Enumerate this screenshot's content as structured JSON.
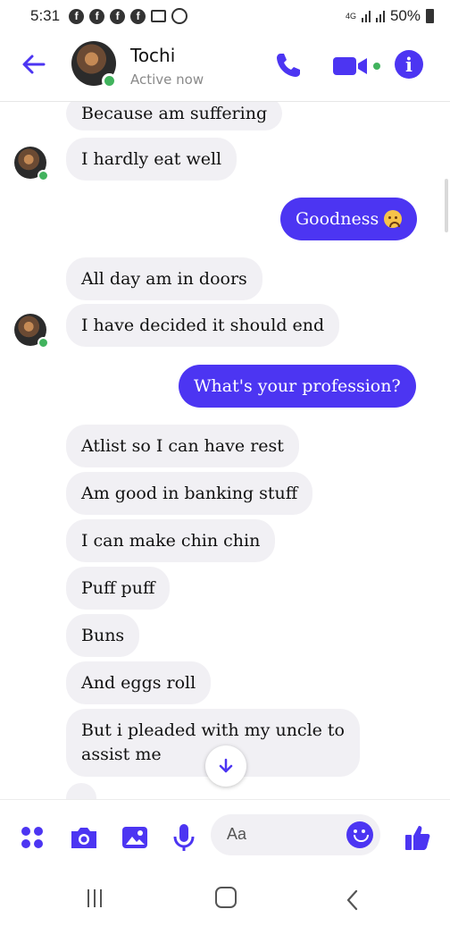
{
  "status_bar": {
    "time": "5:31",
    "network": "4G",
    "battery": "50%"
  },
  "header": {
    "name": "Tochi",
    "status": "Active now"
  },
  "messages": [
    {
      "from": "them",
      "text": "Because am suffering"
    },
    {
      "from": "them",
      "text": "I hardly eat well"
    },
    {
      "from": "me",
      "text": "Goodness",
      "emoji": "sad-face-emoji"
    },
    {
      "from": "them",
      "text": "All day am in doors"
    },
    {
      "from": "them",
      "text": "I have decided it should end"
    },
    {
      "from": "me",
      "text": "What's your profession?"
    },
    {
      "from": "them",
      "text": "Atlist so I can have rest"
    },
    {
      "from": "them",
      "text": "Am good in banking stuff"
    },
    {
      "from": "them",
      "text": "I can make chin chin"
    },
    {
      "from": "them",
      "text": "Puff puff"
    },
    {
      "from": "them",
      "text": "Buns"
    },
    {
      "from": "them",
      "text": "And eggs roll"
    },
    {
      "from": "them",
      "text": "But i pleaded with my uncle to assist me",
      "line1": "But i pleaded with my uncle to",
      "line2": "assist me"
    }
  ],
  "composer": {
    "placeholder": "Aa"
  },
  "colors": {
    "accent": "#4c35f2",
    "incoming_bubble": "#f1f0f4",
    "online": "#41b35d"
  }
}
